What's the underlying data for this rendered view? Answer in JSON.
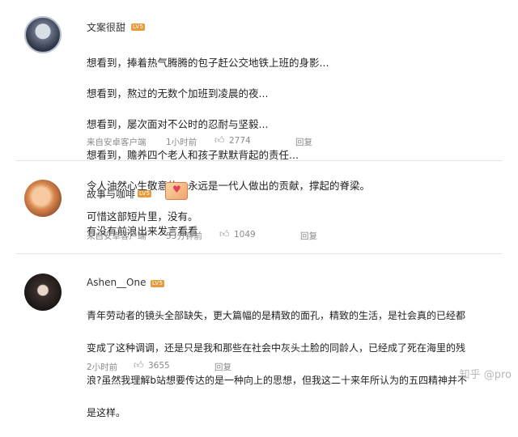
{
  "comments": [
    {
      "username": "文案很甜",
      "badge": "LV5",
      "lines": [
        "想看到，捧着热气腾腾的包子赶公交地铁上班的身影...",
        "想看到，熬过的无数个加班到凌晨的夜...",
        "想看到，屡次面对不公时的忍耐与坚毅...",
        "想看到，赡养四个老人和孩子默默背起的责任...",
        "令人油然心生敬意的，永远是一代人做出的贡献，撑起的脊梁。",
        "可惜这部短片里，没有。"
      ],
      "source": "来自安卓客户端",
      "time": "1小时前",
      "likes": "2774",
      "reply": "回复",
      "thumb_icon": "thumb-up-icon"
    },
    {
      "username": "故事与咖啡",
      "badge": "LV5",
      "lines": [
        "有没有前浪出来发言看看"
      ],
      "source": "来自安卓客户端",
      "time": "53分钟前",
      "likes": "1049",
      "reply": "回复",
      "thumb_icon": "thumb-up-icon"
    },
    {
      "username": "Ashen__One",
      "badge": "LV5",
      "lines": [
        "青年劳动者的镜头全部缺失，更大篇幅的是精致的面孔，精致的生活，是社会真的已经都",
        "变成了这种调调，还是只是我和那些在社会中灰头土脸的同龄人，已经成了死在海里的残",
        "浪?虽然我理解b站想要传达的是一种向上的思想，但我这二十来年所认为的五四精神并不",
        "是这样。"
      ],
      "source": "",
      "time": "2小时前",
      "likes": "3655",
      "reply": "回复",
      "thumb_icon": "thumb-up-icon"
    }
  ],
  "watermark": "知乎 @pro",
  "colors": {
    "badge": "#e79a3a",
    "meta": "#8a8a8a",
    "divider": "#e6e6e6"
  }
}
